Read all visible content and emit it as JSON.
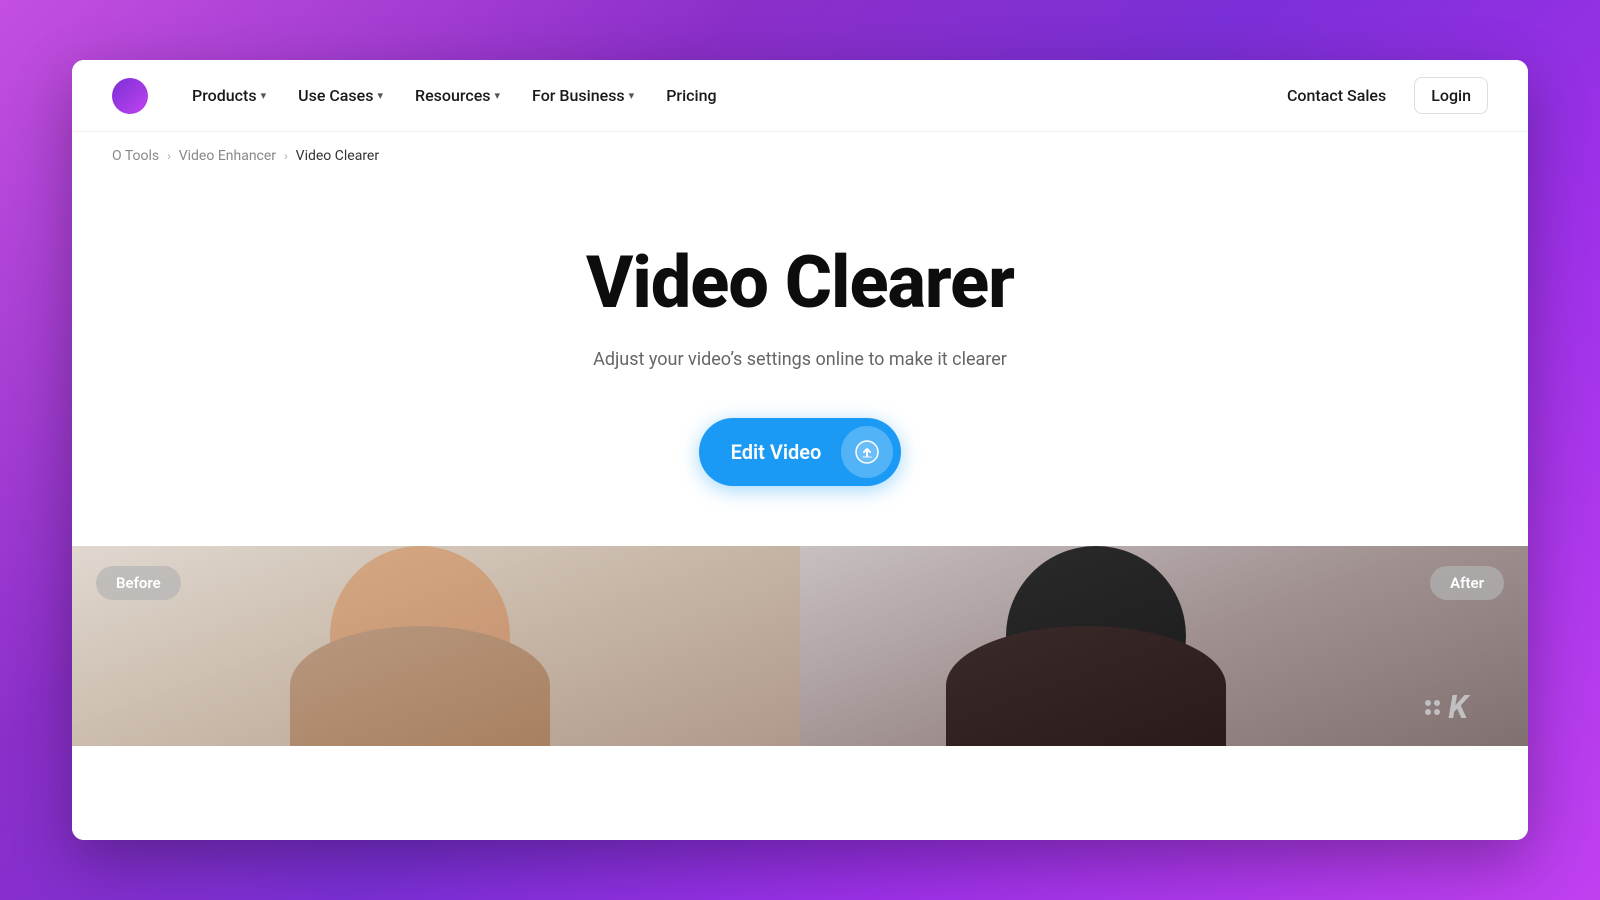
{
  "background": {
    "gradient_start": "#c44fe0",
    "gradient_end": "#9b30e8"
  },
  "navbar": {
    "logo_alt": "Kapwing logo",
    "nav_items": [
      {
        "label": "Products",
        "has_dropdown": true
      },
      {
        "label": "Use Cases",
        "has_dropdown": true
      },
      {
        "label": "Resources",
        "has_dropdown": true
      },
      {
        "label": "For Business",
        "has_dropdown": true
      },
      {
        "label": "Pricing",
        "has_dropdown": false
      }
    ],
    "contact_sales_label": "Contact Sales",
    "login_label": "Login"
  },
  "breadcrumb": {
    "items": [
      {
        "label": "O Tools",
        "active": false
      },
      {
        "label": "Video Enhancer",
        "active": false
      },
      {
        "label": "Video Clearer",
        "active": true
      }
    ]
  },
  "hero": {
    "title": "Video Clearer",
    "subtitle": "Adjust your video’s settings online to make it clearer",
    "cta_label": "Edit Video",
    "upload_icon": "⬆"
  },
  "before_after": {
    "before_label": "Before",
    "after_label": "After"
  },
  "watermark": {
    "letter": "K"
  }
}
